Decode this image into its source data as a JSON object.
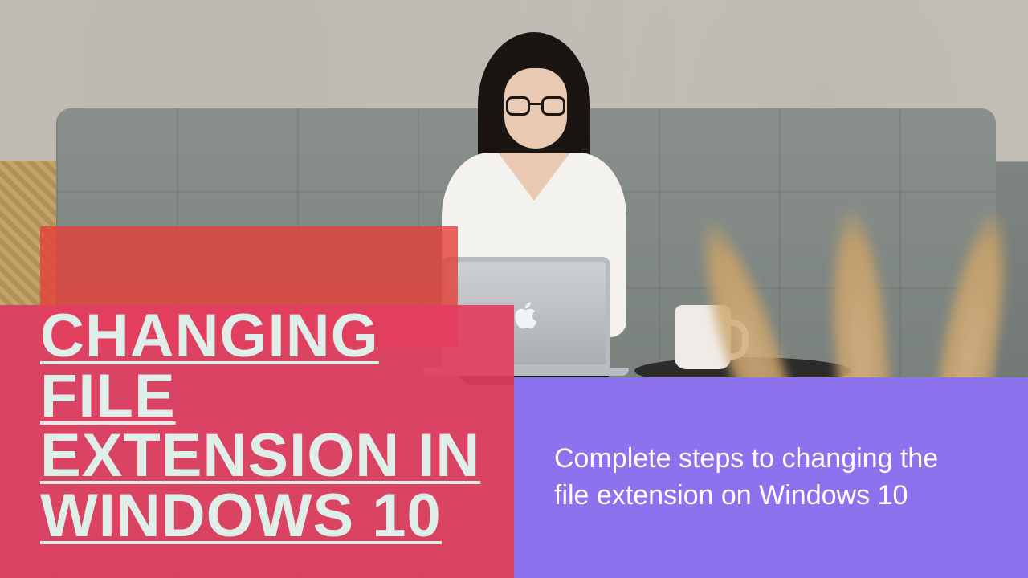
{
  "title": "CHANGING FILE EXTENSION IN WINDOWS 10",
  "subtitle": "Complete steps to changing the file extension on Windows 10",
  "colors": {
    "panel_left": "#e33e61",
    "title_backdrop": "#e4423a",
    "panel_right": "#8d72ee",
    "title_text": "#dfeee9",
    "subtitle_text": "#ffffff"
  },
  "scene": {
    "description": "Woman with long dark hair and glasses in a white shirt sitting on a grey tufted couch using a silver laptop with a logo; white mug on a dark round tray; blurred dried pampas grass in foreground right; woven basket at left.",
    "laptop_logo": "apple-logo"
  }
}
